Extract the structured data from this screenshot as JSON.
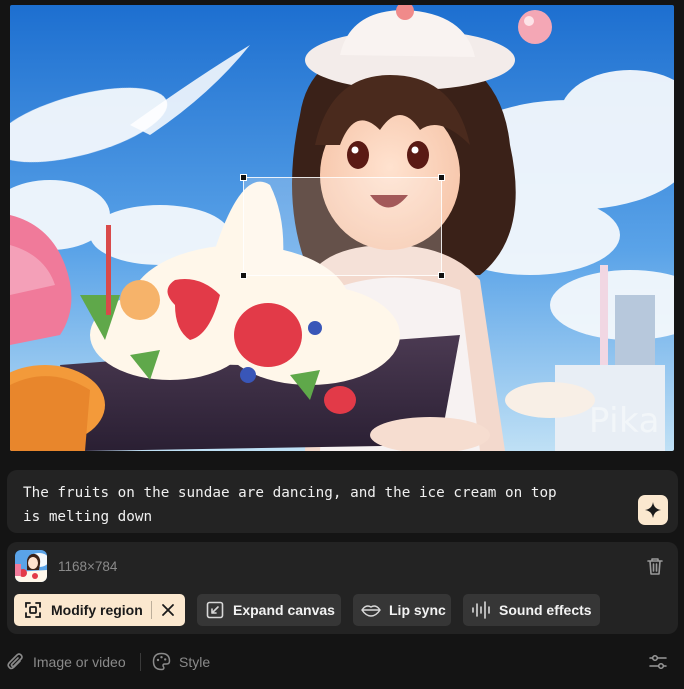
{
  "preview": {
    "watermark": "Pika"
  },
  "prompt": {
    "text": "The fruits on the sundae are dancing, and the ice cream on top\nis melting down",
    "enhance_icon": "sparkle-icon"
  },
  "source_image": {
    "dimensions": "1168×784",
    "delete_icon": "trash-icon"
  },
  "tools": {
    "modify_region": "Modify region",
    "expand_canvas": "Expand canvas",
    "lip_sync": "Lip sync",
    "sound_effects": "Sound effects"
  },
  "bottom_bar": {
    "attach_label": "Image or video",
    "style_label": "Style",
    "settings_icon": "sliders-icon"
  },
  "colors": {
    "background": "#141414",
    "panel": "#232323",
    "chip": "#363636",
    "accent": "#fbe8cf"
  }
}
